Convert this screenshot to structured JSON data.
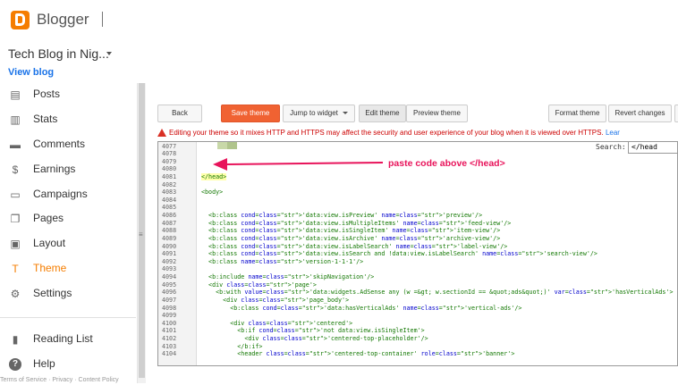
{
  "app": {
    "title": "Blogger"
  },
  "blog": {
    "name": "Tech Blog in Nig...",
    "view_label": "View blog"
  },
  "sidebar": {
    "items": [
      {
        "label": "Posts",
        "icon": "posts-icon"
      },
      {
        "label": "Stats",
        "icon": "stats-icon"
      },
      {
        "label": "Comments",
        "icon": "comments-icon"
      },
      {
        "label": "Earnings",
        "icon": "dollar-icon"
      },
      {
        "label": "Campaigns",
        "icon": "campaigns-icon"
      },
      {
        "label": "Pages",
        "icon": "pages-icon"
      },
      {
        "label": "Layout",
        "icon": "layout-icon"
      },
      {
        "label": "Theme",
        "icon": "theme-icon",
        "active": true
      },
      {
        "label": "Settings",
        "icon": "gear-icon"
      },
      {
        "label": "Reading List",
        "icon": "bookmark-icon"
      },
      {
        "label": "Help",
        "icon": "help-icon"
      }
    ],
    "footer": "Terms of Service · Privacy · Content Policy"
  },
  "toolbar": {
    "back": "Back",
    "save": "Save theme",
    "jump": "Jump to widget",
    "edit": "Edit theme",
    "preview": "Preview theme",
    "format": "Format theme",
    "revert": "Revert changes"
  },
  "warning": {
    "text": "Editing your theme so it mixes HTTP and HTTPS may affect the security and user experience of your blog when it is viewed over HTTPS.",
    "link": "Lear"
  },
  "search": {
    "label": "Search:",
    "value": "</head"
  },
  "annotation": "paste code above </head>",
  "editor": {
    "lines": [
      {
        "n": "4077",
        "code": ""
      },
      {
        "n": "4078",
        "code": ""
      },
      {
        "n": "4079",
        "code": ""
      },
      {
        "n": "4080",
        "code": ""
      },
      {
        "n": "4081",
        "code": "</head>"
      },
      {
        "n": "4082",
        "code": ""
      },
      {
        "n": "4083",
        "code": "<body>"
      },
      {
        "n": "4084",
        "code": ""
      },
      {
        "n": "4085",
        "code": ""
      },
      {
        "n": "4086",
        "code": "  <b:class cond='data:view.isPreview' name='preview'/>"
      },
      {
        "n": "4087",
        "code": "  <b:class cond='data:view.isMultipleItems' name='feed-view'/>"
      },
      {
        "n": "4088",
        "code": "  <b:class cond='data:view.isSingleItem' name='item-view'/>"
      },
      {
        "n": "4089",
        "code": "  <b:class cond='data:view.isArchive' name='archive-view'/>"
      },
      {
        "n": "4090",
        "code": "  <b:class cond='data:view.isLabelSearch' name='label-view'/>"
      },
      {
        "n": "4091",
        "code": "  <b:class cond='data:view.isSearch and !data:view.isLabelSearch' name='search-view'/>"
      },
      {
        "n": "4092",
        "code": "  <b:class name='version-1-1-1'/>"
      },
      {
        "n": "4093",
        "code": ""
      },
      {
        "n": "4094",
        "code": "  <b:include name='skipNavigation'/>"
      },
      {
        "n": "4095",
        "code": "  <div class='page'>"
      },
      {
        "n": "4096",
        "code": "    <b:with value='data:widgets.AdSense any (w =&gt; w.sectionId == &quot;ads&quot;)' var='hasVerticalAds'>"
      },
      {
        "n": "4097",
        "code": "      <div class='page_body'>"
      },
      {
        "n": "4098",
        "code": "        <b:class cond='data:hasVerticalAds' name='vertical-ads'/>"
      },
      {
        "n": "4099",
        "code": ""
      },
      {
        "n": "4100",
        "code": "        <div class='centered'>"
      },
      {
        "n": "4101",
        "code": "          <b:if cond='not data:view.isSingleItem'>"
      },
      {
        "n": "4102",
        "code": "            <div class='centered-top-placeholder'/>"
      },
      {
        "n": "4103",
        "code": "          </b:if>"
      },
      {
        "n": "4104",
        "code": "          <header class='centered-top-container' role='banner'>"
      }
    ]
  },
  "colors": {
    "accent": "#f57d00",
    "save_button": "#f06232",
    "annotation": "#e8145b",
    "warning": "#cc0000"
  }
}
